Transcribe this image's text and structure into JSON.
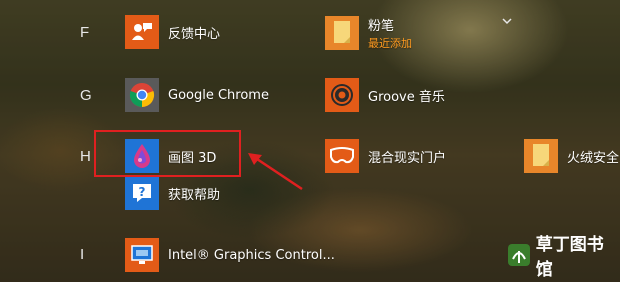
{
  "sections": [
    {
      "letter": "F"
    },
    {
      "letter": "G"
    },
    {
      "letter": "H"
    },
    {
      "letter": "I"
    }
  ],
  "apps": {
    "feedback_hub": {
      "label": "反馈中心",
      "icon": "feedback-icon",
      "color": "#e35b17"
    },
    "sticky_notes": {
      "label": "粉笔",
      "sublabel": "最近添加",
      "icon": "sticky-note-icon",
      "color": "#e8862a"
    },
    "chrome": {
      "label": "Google Chrome",
      "icon": "chrome-icon",
      "color": "#5a5a5a"
    },
    "groove": {
      "label": "Groove 音乐",
      "icon": "groove-music-icon",
      "color": "#e35b17"
    },
    "paint3d": {
      "label": "画图 3D",
      "icon": "paint-3d-icon",
      "color": "#1f74d6"
    },
    "mixed_reality": {
      "label": "混合现实门户",
      "icon": "mixed-reality-icon",
      "color": "#e35b17"
    },
    "huorong": {
      "label": "火绒安全家",
      "icon": "sticky-note-icon",
      "color": "#e8862a"
    },
    "get_help": {
      "label": "获取帮助",
      "icon": "help-icon",
      "color": "#1f74d6"
    },
    "intel_graphics": {
      "label": "Intel® Graphics Control...",
      "icon": "intel-graphics-icon",
      "color": "#e35b17"
    }
  },
  "annotation": {
    "highlight_color": "#e02020"
  },
  "watermark": {
    "text": "草丁图书馆"
  }
}
